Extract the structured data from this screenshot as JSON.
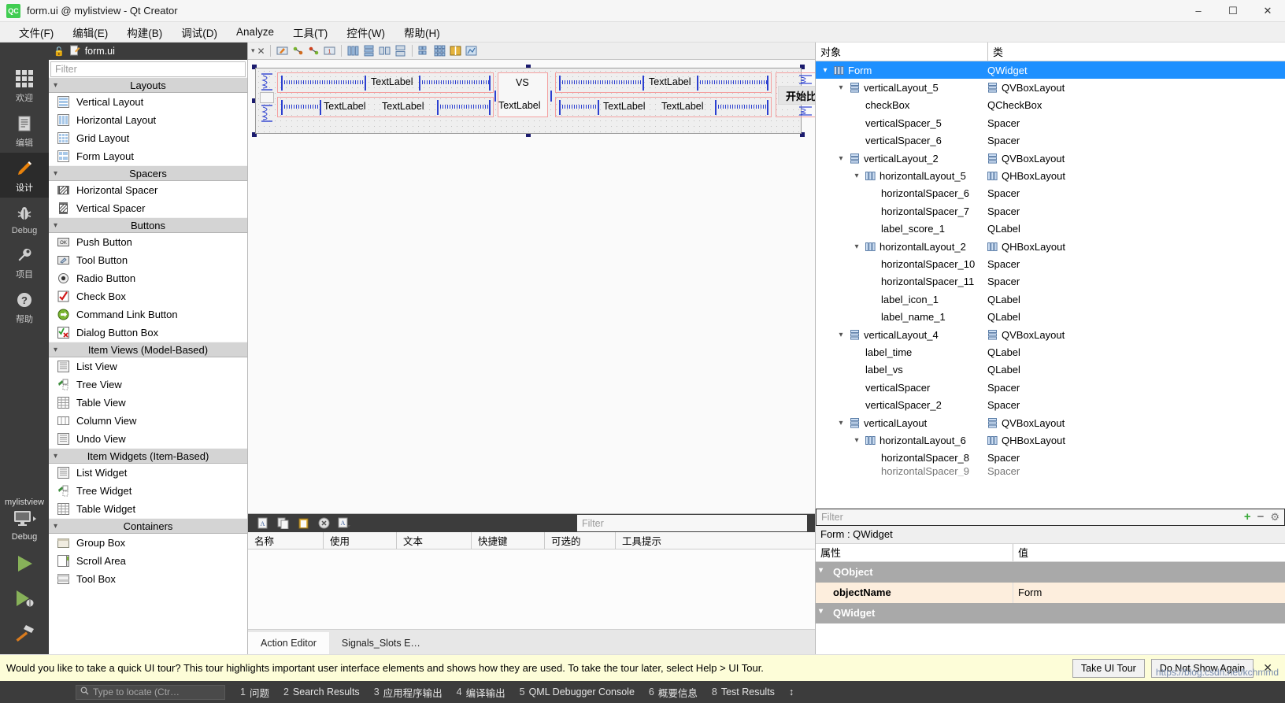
{
  "window": {
    "title": "form.ui @ mylistview - Qt Creator",
    "logo_text": "QC",
    "minimize": "–",
    "maximize": "☐",
    "close": "✕"
  },
  "menubar": [
    {
      "label": "文件(F)",
      "accel": "F"
    },
    {
      "label": "编辑(E)",
      "accel": "E"
    },
    {
      "label": "构建(B)",
      "accel": "B"
    },
    {
      "label": "调试(D)",
      "accel": "D"
    },
    {
      "label": "Analyze",
      "accel": "A"
    },
    {
      "label": "工具(T)",
      "accel": "T"
    },
    {
      "label": "控件(W)",
      "accel": "W"
    },
    {
      "label": "帮助(H)",
      "accel": "H"
    }
  ],
  "modebar": {
    "modes": [
      {
        "label": "欢迎",
        "icon": "grid-icon",
        "active": false
      },
      {
        "label": "编辑",
        "icon": "document-icon",
        "active": false
      },
      {
        "label": "设计",
        "icon": "pencil-icon",
        "active": true
      },
      {
        "label": "Debug",
        "icon": "bug-icon",
        "active": false
      },
      {
        "label": "项目",
        "icon": "wrench-icon",
        "active": false
      },
      {
        "label": "帮助",
        "icon": "question-icon",
        "active": false
      }
    ],
    "kit_name": "mylistview",
    "kit_config": "Debug",
    "run_icon": "play-icon",
    "debug_icon": "play-debug-icon",
    "build_icon": "hammer-icon"
  },
  "widgetbox": {
    "header_file": "form.ui",
    "header_icon": "form-file-icon",
    "lock_icon": "unlock-icon",
    "filter_placeholder": "Filter",
    "groups": [
      {
        "title": "Layouts",
        "items": [
          {
            "label": "Vertical Layout",
            "icon": "vertical-layout-icon"
          },
          {
            "label": "Horizontal Layout",
            "icon": "horizontal-layout-icon"
          },
          {
            "label": "Grid Layout",
            "icon": "grid-layout-icon"
          },
          {
            "label": "Form Layout",
            "icon": "form-layout-icon"
          }
        ]
      },
      {
        "title": "Spacers",
        "items": [
          {
            "label": "Horizontal Spacer",
            "icon": "horizontal-spacer-icon"
          },
          {
            "label": "Vertical Spacer",
            "icon": "vertical-spacer-icon"
          }
        ]
      },
      {
        "title": "Buttons",
        "items": [
          {
            "label": "Push Button",
            "icon": "push-button-icon"
          },
          {
            "label": "Tool Button",
            "icon": "tool-button-icon"
          },
          {
            "label": "Radio Button",
            "icon": "radio-button-icon"
          },
          {
            "label": "Check Box",
            "icon": "check-box-icon"
          },
          {
            "label": "Command Link Button",
            "icon": "command-link-icon"
          },
          {
            "label": "Dialog Button Box",
            "icon": "dialog-button-box-icon"
          }
        ]
      },
      {
        "title": "Item Views (Model-Based)",
        "items": [
          {
            "label": "List View",
            "icon": "list-view-icon"
          },
          {
            "label": "Tree View",
            "icon": "tree-view-icon"
          },
          {
            "label": "Table View",
            "icon": "table-view-icon"
          },
          {
            "label": "Column View",
            "icon": "column-view-icon"
          },
          {
            "label": "Undo View",
            "icon": "undo-view-icon"
          }
        ]
      },
      {
        "title": "Item Widgets (Item-Based)",
        "items": [
          {
            "label": "List Widget",
            "icon": "list-widget-icon"
          },
          {
            "label": "Tree Widget",
            "icon": "tree-widget-icon"
          },
          {
            "label": "Table Widget",
            "icon": "table-widget-icon"
          }
        ]
      },
      {
        "title": "Containers",
        "items": [
          {
            "label": "Group Box",
            "icon": "group-box-icon"
          },
          {
            "label": "Scroll Area",
            "icon": "scroll-area-icon"
          },
          {
            "label": "Tool Box",
            "icon": "tool-box-icon"
          }
        ]
      }
    ]
  },
  "designer": {
    "tab_label": "form.ui",
    "form_labels": {
      "text_label": "TextLabel",
      "vs": "VS",
      "start_button": "开始比赛"
    },
    "preview": {
      "row1_left": "TextLabel",
      "row2_left_a": "TextLabel",
      "row2_left_b": "TextLabel",
      "vs_top": "VS",
      "vs_bottom": "TextLabel",
      "row1_right": "TextLabel",
      "row2_right_a": "TextLabel",
      "row2_right_b": "TextLabel",
      "button": "开始比赛"
    }
  },
  "action_editor": {
    "filter_placeholder": "Filter",
    "columns": [
      "名称",
      "使用",
      "文本",
      "快捷键",
      "可选的",
      "工具提示"
    ],
    "rows": [],
    "tabs": [
      {
        "label": "Action Editor",
        "active": true
      },
      {
        "label": "Signals_Slots E…",
        "active": false
      }
    ],
    "toolbar_icons": [
      "new-action-icon",
      "copy-icon",
      "paste-icon",
      "delete-icon",
      "view-mode-icon"
    ]
  },
  "object_inspector": {
    "columns": [
      "对象",
      "类"
    ],
    "rows": [
      {
        "indent": 0,
        "name": "Form",
        "cls": "QWidget",
        "expand": "v",
        "icon": "hbox-icon",
        "cls_icon": "hbox-icon",
        "selected": true
      },
      {
        "indent": 1,
        "name": "verticalLayout_5",
        "cls": "QVBoxLayout",
        "expand": "v",
        "icon": "vbox-icon",
        "cls_icon": "vbox-icon",
        "selected": false
      },
      {
        "indent": 2,
        "name": "checkBox",
        "cls": "QCheckBox",
        "expand": "",
        "icon": "",
        "cls_icon": "",
        "selected": false
      },
      {
        "indent": 2,
        "name": "verticalSpacer_5",
        "cls": "Spacer",
        "expand": "",
        "icon": "",
        "cls_icon": "",
        "selected": false
      },
      {
        "indent": 2,
        "name": "verticalSpacer_6",
        "cls": "Spacer",
        "expand": "",
        "icon": "",
        "cls_icon": "",
        "selected": false
      },
      {
        "indent": 1,
        "name": "verticalLayout_2",
        "cls": "QVBoxLayout",
        "expand": "v",
        "icon": "vbox-icon",
        "cls_icon": "vbox-icon",
        "selected": false
      },
      {
        "indent": 2,
        "name": "horizontalLayout_5",
        "cls": "QHBoxLayout",
        "expand": "v",
        "icon": "hbox-icon",
        "cls_icon": "hbox-icon",
        "selected": false
      },
      {
        "indent": 3,
        "name": "horizontalSpacer_6",
        "cls": "Spacer",
        "expand": "",
        "icon": "",
        "cls_icon": "",
        "selected": false
      },
      {
        "indent": 3,
        "name": "horizontalSpacer_7",
        "cls": "Spacer",
        "expand": "",
        "icon": "",
        "cls_icon": "",
        "selected": false
      },
      {
        "indent": 3,
        "name": "label_score_1",
        "cls": "QLabel",
        "expand": "",
        "icon": "",
        "cls_icon": "",
        "selected": false
      },
      {
        "indent": 2,
        "name": "horizontalLayout_2",
        "cls": "QHBoxLayout",
        "expand": "v",
        "icon": "hbox-icon",
        "cls_icon": "hbox-icon",
        "selected": false
      },
      {
        "indent": 3,
        "name": "horizontalSpacer_10",
        "cls": "Spacer",
        "expand": "",
        "icon": "",
        "cls_icon": "",
        "selected": false
      },
      {
        "indent": 3,
        "name": "horizontalSpacer_11",
        "cls": "Spacer",
        "expand": "",
        "icon": "",
        "cls_icon": "",
        "selected": false
      },
      {
        "indent": 3,
        "name": "label_icon_1",
        "cls": "QLabel",
        "expand": "",
        "icon": "",
        "cls_icon": "",
        "selected": false
      },
      {
        "indent": 3,
        "name": "label_name_1",
        "cls": "QLabel",
        "expand": "",
        "icon": "",
        "cls_icon": "",
        "selected": false
      },
      {
        "indent": 1,
        "name": "verticalLayout_4",
        "cls": "QVBoxLayout",
        "expand": "v",
        "icon": "vbox-icon",
        "cls_icon": "vbox-icon",
        "selected": false
      },
      {
        "indent": 2,
        "name": "label_time",
        "cls": "QLabel",
        "expand": "",
        "icon": "",
        "cls_icon": "",
        "selected": false
      },
      {
        "indent": 2,
        "name": "label_vs",
        "cls": "QLabel",
        "expand": "",
        "icon": "",
        "cls_icon": "",
        "selected": false
      },
      {
        "indent": 2,
        "name": "verticalSpacer",
        "cls": "Spacer",
        "expand": "",
        "icon": "",
        "cls_icon": "",
        "selected": false
      },
      {
        "indent": 2,
        "name": "verticalSpacer_2",
        "cls": "Spacer",
        "expand": "",
        "icon": "",
        "cls_icon": "",
        "selected": false
      },
      {
        "indent": 1,
        "name": "verticalLayout",
        "cls": "QVBoxLayout",
        "expand": "v",
        "icon": "vbox-icon",
        "cls_icon": "vbox-icon",
        "selected": false
      },
      {
        "indent": 2,
        "name": "horizontalLayout_6",
        "cls": "QHBoxLayout",
        "expand": "v",
        "icon": "hbox-icon",
        "cls_icon": "hbox-icon",
        "selected": false
      },
      {
        "indent": 3,
        "name": "horizontalSpacer_8",
        "cls": "Spacer",
        "expand": "",
        "icon": "",
        "cls_icon": "",
        "selected": false
      },
      {
        "indent": 3,
        "name": "horizontalSpacer_9",
        "cls": "Spacer",
        "expand": "",
        "icon": "",
        "cls_icon": "",
        "selected": false
      }
    ]
  },
  "property_editor": {
    "filter_placeholder": "Filter",
    "add_icon": "plus-icon",
    "remove_icon": "minus-icon",
    "config_icon": "gear-icon",
    "object_label": "Form : QWidget",
    "columns": [
      "属性",
      "值"
    ],
    "rows": [
      {
        "kind": "group",
        "name": "QObject",
        "value": ""
      },
      {
        "kind": "value",
        "name": "objectName",
        "value": "Form"
      },
      {
        "kind": "group",
        "name": "QWidget",
        "value": ""
      }
    ]
  },
  "notification": {
    "message": "Would you like to take a quick UI tour? This tour highlights important user interface elements and shows how they are used. To take the tour later, select Help > UI Tour.",
    "primary_button": "Take UI Tour",
    "secondary_button": "Do Not Show Again",
    "close": "✕"
  },
  "statusbar": {
    "search_placeholder": "Type to locate (Ctr…",
    "search_icon": "magnifier-icon",
    "items": [
      {
        "num": "1",
        "label": "问题"
      },
      {
        "num": "2",
        "label": "Search Results"
      },
      {
        "num": "3",
        "label": "应用程序输出"
      },
      {
        "num": "4",
        "label": "编译输出"
      },
      {
        "num": "5",
        "label": "QML Debugger Console"
      },
      {
        "num": "6",
        "label": "概要信息"
      },
      {
        "num": "8",
        "label": "Test Results"
      }
    ],
    "updown": "↕"
  },
  "watermark": "https://blog.csdn.net/kchmmd",
  "colors": {
    "accent": "#1e90ff",
    "dark_panel": "#3c3c3c",
    "notify_bg": "#fdfdd8",
    "prop_value_bg": "#fdeedd",
    "qt_green": "#41cd52"
  }
}
